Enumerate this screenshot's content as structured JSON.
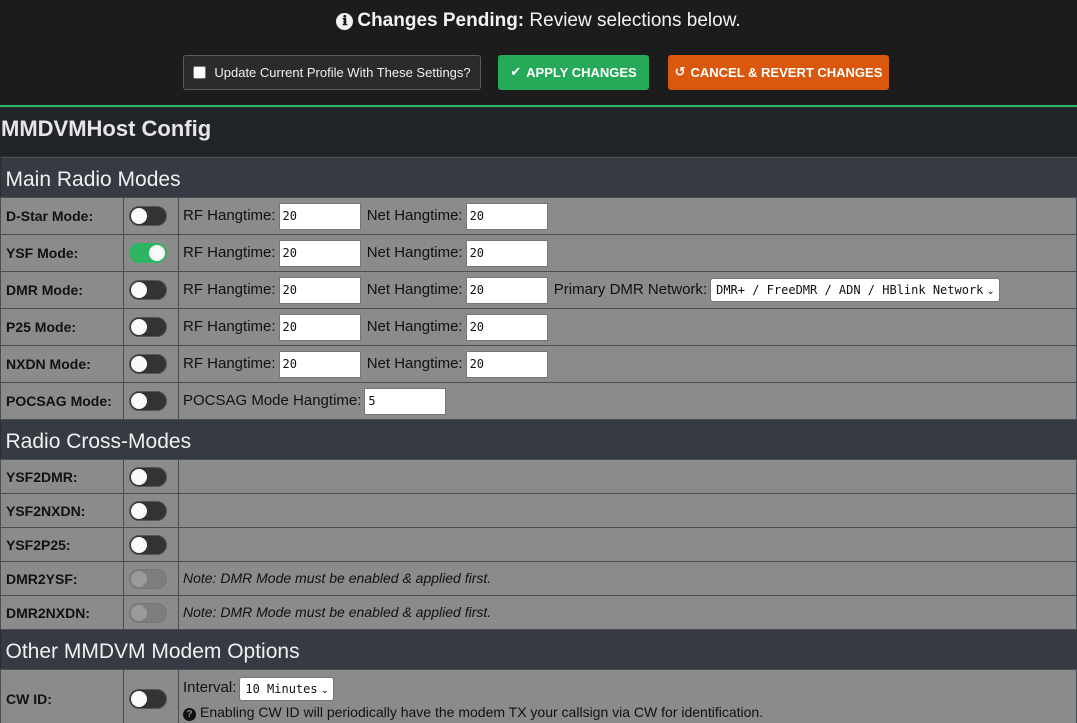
{
  "banner": {
    "title_bold": "Changes Pending:",
    "title_rest": "Review selections below.",
    "info_icon": "ℹ",
    "profile_checkbox_label": "Update Current Profile With These Settings?",
    "apply_label": "APPLY CHANGES",
    "apply_icon": "✔",
    "cancel_label": "CANCEL & REVERT CHANGES",
    "cancel_icon": "↺"
  },
  "page_title": "MMDVMHost Config",
  "labels": {
    "rf_hangtime": "RF Hangtime:",
    "net_hangtime": "Net Hangtime:",
    "primary_dmr": "Primary DMR Network:",
    "pocsag_hangtime": "POCSAG Mode Hangtime:",
    "interval": "Interval:"
  },
  "sections": {
    "main": {
      "title": "Main Radio Modes",
      "rows": [
        {
          "label": "D-Star Mode:",
          "enabled": false,
          "rf": "20",
          "net": "20"
        },
        {
          "label": "YSF Mode:",
          "enabled": true,
          "rf": "20",
          "net": "20"
        },
        {
          "label": "DMR Mode:",
          "enabled": false,
          "rf": "20",
          "net": "20",
          "network": "DMR+ / FreeDMR / ADN / HBlink Network"
        },
        {
          "label": "P25 Mode:",
          "enabled": false,
          "rf": "20",
          "net": "20"
        },
        {
          "label": "NXDN Mode:",
          "enabled": false,
          "rf": "20",
          "net": "20"
        },
        {
          "label": "POCSAG Mode:",
          "enabled": false,
          "hangtime": "5"
        }
      ]
    },
    "cross": {
      "title": "Radio Cross-Modes",
      "rows": [
        {
          "label": "YSF2DMR:",
          "enabled": false
        },
        {
          "label": "YSF2NXDN:",
          "enabled": false
        },
        {
          "label": "YSF2P25:",
          "enabled": false
        },
        {
          "label": "DMR2YSF:",
          "enabled": false,
          "disabled": true,
          "note": "Note: DMR Mode must be enabled & applied first."
        },
        {
          "label": "DMR2NXDN:",
          "enabled": false,
          "disabled": true,
          "note": "Note: DMR Mode must be enabled & applied first."
        }
      ]
    },
    "other": {
      "title": "Other MMDVM Modem Options",
      "rows": [
        {
          "label": "CW ID:",
          "enabled": false,
          "interval": "10 Minutes",
          "help": "Enabling CW ID will periodically have the modem TX your callsign via CW for identification."
        }
      ]
    }
  },
  "colors": {
    "accent_green": "#2fb463",
    "apply_green": "#27a95a",
    "cancel_orange": "#d9580d",
    "row_gray": "#8b8b8b",
    "section_header": "#363a42"
  }
}
